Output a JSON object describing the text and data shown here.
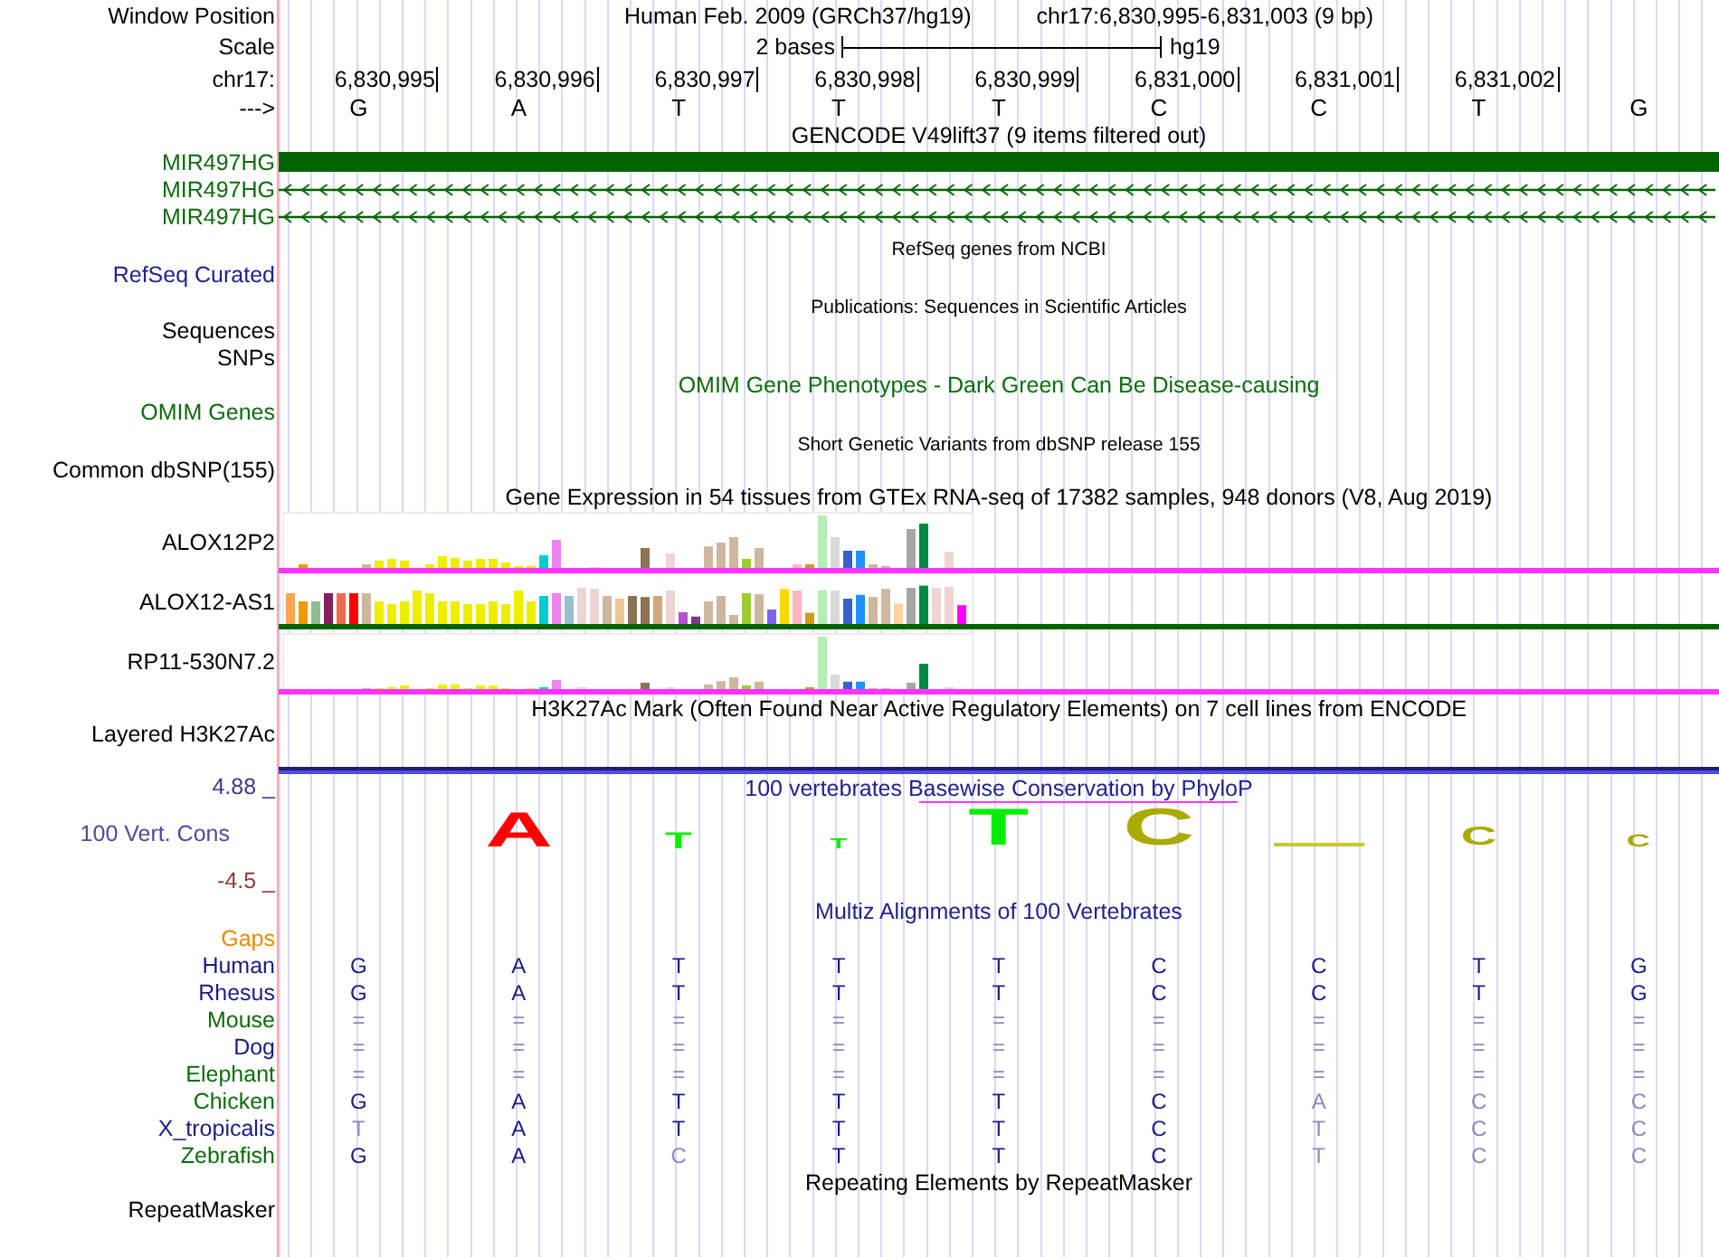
{
  "header": {
    "label": "Window Position",
    "assembly": "Human Feb. 2009 (GRCh37/hg19)",
    "location": "chr17:6,830,995-6,831,003 (9 bp)"
  },
  "scale": {
    "label": "Scale",
    "length": "2 bases",
    "assembly": "hg19"
  },
  "ruler": {
    "label": "chr17:",
    "positions": [
      "6,830,995",
      "6,830,996",
      "6,830,997",
      "6,830,998",
      "6,830,999",
      "6,831,000",
      "6,831,001",
      "6,831,002"
    ]
  },
  "sequence": {
    "label": "--->",
    "bases": [
      "G",
      "A",
      "T",
      "T",
      "T",
      "C",
      "C",
      "T",
      "G"
    ]
  },
  "tracks": [
    {
      "kind": "genes",
      "title": "GENCODE V49lift37 (9 items filtered out)",
      "items": [
        {
          "label": "MIR497HG",
          "kind": "block"
        },
        {
          "label": "MIR497HG",
          "kind": "intron"
        },
        {
          "label": "MIR497HG",
          "kind": "intron"
        }
      ]
    },
    {
      "kind": "minor",
      "title": "RefSeq genes from NCBI",
      "color": "#22228c",
      "labels": [
        "RefSeq Curated"
      ]
    },
    {
      "kind": "minor",
      "title": "Publications: Sequences in Scientific Articles",
      "color": "#000000",
      "labels": [
        "Sequences",
        "SNPs"
      ]
    },
    {
      "kind": "titled",
      "title": "OMIM Gene Phenotypes - Dark Green Can Be Disease-causing",
      "color": "#0d6b0d",
      "labels": [
        "OMIM Genes"
      ]
    },
    {
      "kind": "minor",
      "title": "Short Genetic Variants from dbSNP release 155",
      "color": "#000000",
      "labels": [
        "Common dbSNP(155)"
      ]
    },
    {
      "kind": "expression",
      "title": "Gene Expression in 54 tissues from GTEx RNA-seq of 17382 samples, 948 donors (V8, Aug 2019)",
      "genes": [
        {
          "label": "ALOX12P2",
          "color": "#ff33ff"
        },
        {
          "label": "ALOX12-AS1",
          "color": "#006400"
        },
        {
          "label": "RP11-530N7.2",
          "color": "#ff33ff"
        }
      ]
    },
    {
      "kind": "signal",
      "title": "H3K27Ac Mark (Often Found Near Active Regulatory Elements) on 7 cell lines from ENCODE",
      "labels": [
        "Layered H3K27Ac"
      ]
    },
    {
      "kind": "conservation",
      "title": "100 vertebrates Basewise Conservation by PhyloP",
      "label": "100 Vert. Cons",
      "max": "4.88 _",
      "min": "-4.5 _",
      "columns": [
        {
          "kind": "blank"
        },
        {
          "kind": "letter",
          "letter": "A",
          "color": "#ff0000"
        },
        {
          "kind": "letter",
          "letter": "T",
          "color": "#00ee00"
        },
        {
          "kind": "letter",
          "letter": "T",
          "color": "#00ee00"
        },
        {
          "kind": "letter",
          "letter": "T",
          "color": "#00ee00"
        },
        {
          "kind": "letter",
          "letter": "C",
          "color": "#aaaa00"
        },
        {
          "kind": "line",
          "color": "#c8c832"
        },
        {
          "kind": "letter",
          "letter": "C",
          "color": "#aaaa00"
        },
        {
          "kind": "letter",
          "letter": "C",
          "color": "#aaaa00"
        }
      ]
    },
    {
      "kind": "alignment",
      "title": "Multiz Alignments of 100 Vertebrates",
      "gaps_label": "Gaps",
      "species": [
        {
          "label": "Human",
          "color": "#1c1c80",
          "bases": [
            {
              "b": "G",
              "dim": false
            },
            {
              "b": "A",
              "dim": false
            },
            {
              "b": "T",
              "dim": false
            },
            {
              "b": "T",
              "dim": false
            },
            {
              "b": "T",
              "dim": false
            },
            {
              "b": "C",
              "dim": false
            },
            {
              "b": "C",
              "dim": false
            },
            {
              "b": "T",
              "dim": false
            },
            {
              "b": "G",
              "dim": false
            }
          ]
        },
        {
          "label": "Rhesus",
          "color": "#1c1c80",
          "bases": [
            {
              "b": "G",
              "dim": false
            },
            {
              "b": "A",
              "dim": false
            },
            {
              "b": "T",
              "dim": false
            },
            {
              "b": "T",
              "dim": false
            },
            {
              "b": "T",
              "dim": false
            },
            {
              "b": "C",
              "dim": false
            },
            {
              "b": "C",
              "dim": false
            },
            {
              "b": "T",
              "dim": false
            },
            {
              "b": "G",
              "dim": false
            }
          ]
        },
        {
          "label": "Mouse",
          "color": "#0d6b0d",
          "bases": [
            {
              "b": "=",
              "dim": true
            },
            {
              "b": "=",
              "dim": true
            },
            {
              "b": "=",
              "dim": true
            },
            {
              "b": "=",
              "dim": true
            },
            {
              "b": "=",
              "dim": true
            },
            {
              "b": "=",
              "dim": true
            },
            {
              "b": "=",
              "dim": true
            },
            {
              "b": "=",
              "dim": true
            },
            {
              "b": "=",
              "dim": true
            }
          ]
        },
        {
          "label": "Dog",
          "color": "#1c1c80",
          "bases": [
            {
              "b": "=",
              "dim": true
            },
            {
              "b": "=",
              "dim": true
            },
            {
              "b": "=",
              "dim": true
            },
            {
              "b": "=",
              "dim": true
            },
            {
              "b": "=",
              "dim": true
            },
            {
              "b": "=",
              "dim": true
            },
            {
              "b": "=",
              "dim": true
            },
            {
              "b": "=",
              "dim": true
            },
            {
              "b": "=",
              "dim": true
            }
          ]
        },
        {
          "label": "Elephant",
          "color": "#0d6b0d",
          "bases": [
            {
              "b": "=",
              "dim": true
            },
            {
              "b": "=",
              "dim": true
            },
            {
              "b": "=",
              "dim": true
            },
            {
              "b": "=",
              "dim": true
            },
            {
              "b": "=",
              "dim": true
            },
            {
              "b": "=",
              "dim": true
            },
            {
              "b": "=",
              "dim": true
            },
            {
              "b": "=",
              "dim": true
            },
            {
              "b": "=",
              "dim": true
            }
          ]
        },
        {
          "label": "Chicken",
          "color": "#0d6b0d",
          "bases": [
            {
              "b": "G",
              "dim": false
            },
            {
              "b": "A",
              "dim": false
            },
            {
              "b": "T",
              "dim": false
            },
            {
              "b": "T",
              "dim": false
            },
            {
              "b": "T",
              "dim": false
            },
            {
              "b": "C",
              "dim": false
            },
            {
              "b": "A",
              "dim": true
            },
            {
              "b": "C",
              "dim": true
            },
            {
              "b": "C",
              "dim": true
            }
          ]
        },
        {
          "label": "X_tropicalis",
          "color": "#1c1c80",
          "bases": [
            {
              "b": "T",
              "dim": true
            },
            {
              "b": "A",
              "dim": false
            },
            {
              "b": "T",
              "dim": false
            },
            {
              "b": "T",
              "dim": false
            },
            {
              "b": "T",
              "dim": false
            },
            {
              "b": "C",
              "dim": false
            },
            {
              "b": "T",
              "dim": true
            },
            {
              "b": "C",
              "dim": true
            },
            {
              "b": "C",
              "dim": true
            }
          ]
        },
        {
          "label": "Zebrafish",
          "color": "#0d6b0d",
          "bases": [
            {
              "b": "G",
              "dim": false
            },
            {
              "b": "A",
              "dim": false
            },
            {
              "b": "C",
              "dim": true
            },
            {
              "b": "T",
              "dim": false
            },
            {
              "b": "T",
              "dim": false
            },
            {
              "b": "C",
              "dim": false
            },
            {
              "b": "T",
              "dim": true
            },
            {
              "b": "C",
              "dim": true
            },
            {
              "b": "C",
              "dim": true
            }
          ]
        }
      ]
    },
    {
      "kind": "titled",
      "title": "Repeating Elements by RepeatMasker",
      "color": "#000000",
      "labels": [
        "RepeatMasker"
      ]
    }
  ]
}
